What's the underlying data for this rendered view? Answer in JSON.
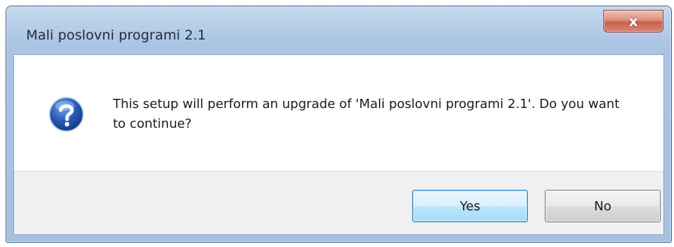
{
  "window": {
    "title": "Mali poslovni programi 2.1",
    "close_label": "x"
  },
  "message": {
    "icon": "question-icon",
    "text": "This setup will perform an upgrade of 'Mali poslovni programi 2.1'. Do you want to continue?"
  },
  "buttons": {
    "yes_label": "Yes",
    "no_label": "No",
    "default": "yes"
  },
  "colors": {
    "title_bar": "#aac4e4",
    "close_button": "#c95f4c",
    "dialog_body": "#ffffff",
    "button_strip": "#f0f0f0",
    "icon_blue": "#1f4fa8"
  }
}
